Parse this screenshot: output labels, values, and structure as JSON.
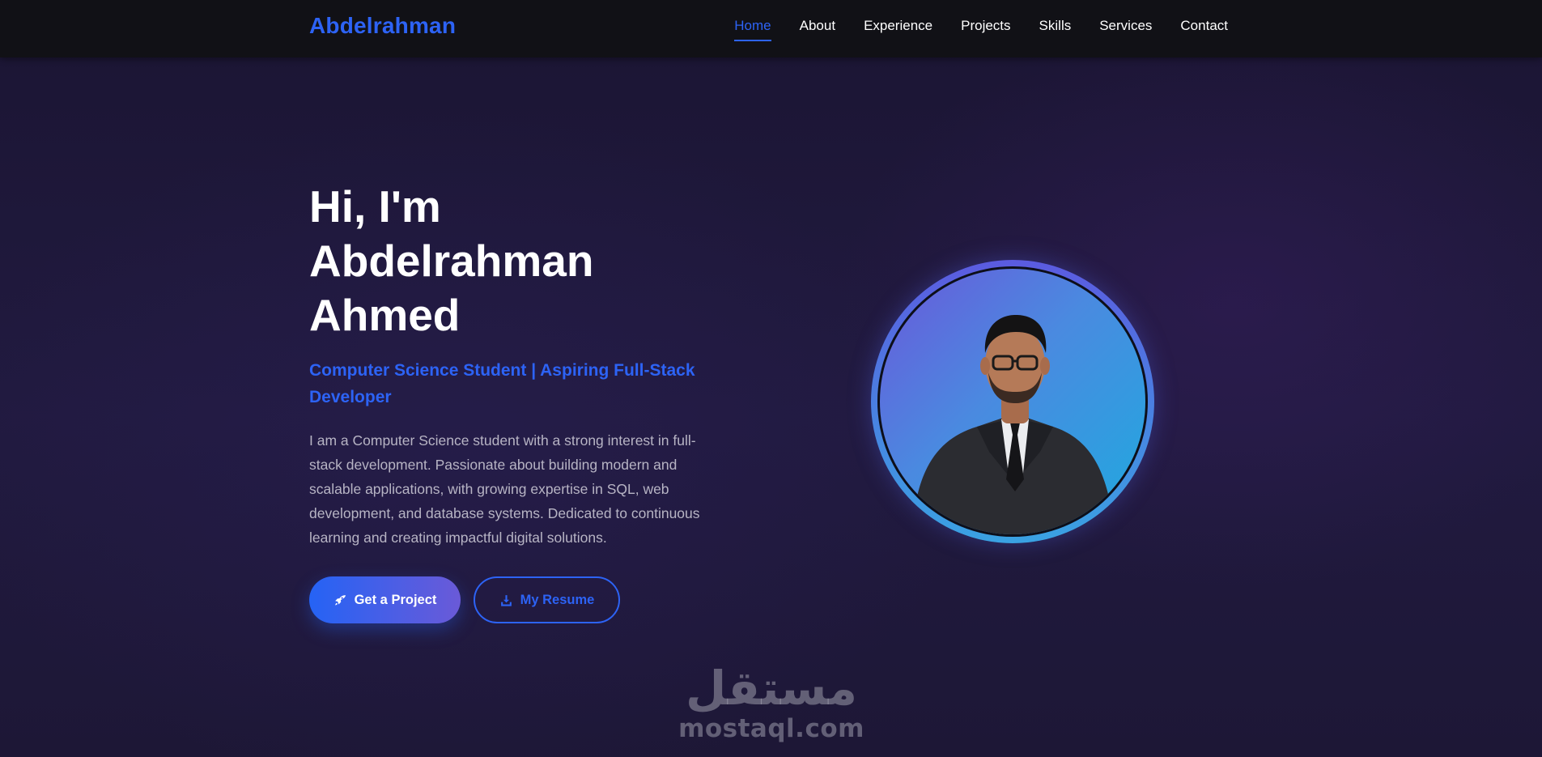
{
  "nav": {
    "logo": "Abdelrahman",
    "links": [
      {
        "label": "Home",
        "active": true
      },
      {
        "label": "About"
      },
      {
        "label": "Experience"
      },
      {
        "label": "Projects"
      },
      {
        "label": "Skills"
      },
      {
        "label": "Services"
      },
      {
        "label": "Contact"
      }
    ]
  },
  "hero": {
    "title_lines": [
      "Hi, I'm",
      "Abdelrahman",
      "Ahmed"
    ],
    "subtitle": "Computer Science Student | Aspiring Full-Stack Developer",
    "description": "I am a Computer Science student with a strong interest in full-stack development. Passionate about building modern and scalable applications, with growing expertise in SQL, web development, and database systems. Dedicated to continuous learning and creating impactful digital solutions.",
    "primary_button": {
      "label": "Get a Project",
      "icon": "rocket-icon"
    },
    "secondary_button": {
      "label": "My Resume",
      "icon": "download-icon"
    }
  },
  "profile": {
    "image": "profile-photo"
  },
  "watermark": {
    "arabic": "مستقل",
    "domain": "mostaql.com"
  },
  "colors": {
    "accent": "#2d63f5",
    "nav_bg": "#111116",
    "page_bg": "#1e1838",
    "ring_start": "#5b5be0",
    "ring_end": "#3aa2e2"
  }
}
